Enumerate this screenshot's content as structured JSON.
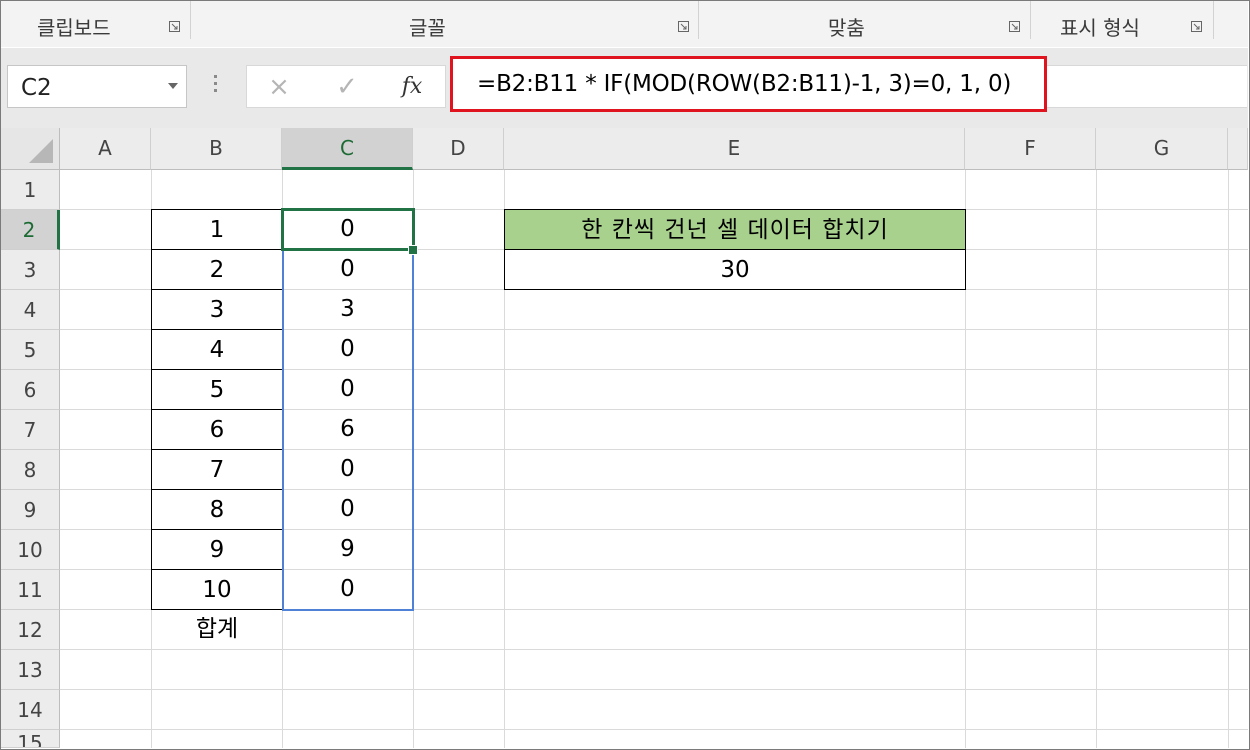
{
  "ribbon": {
    "groups": [
      "클립보드",
      "글꼴",
      "맞춤",
      "표시 형식"
    ],
    "launcher_icon": "dialog-launcher-icon"
  },
  "formula_bar": {
    "name_box": "C2",
    "cancel_icon": "×",
    "enter_icon": "✓",
    "fx_label": "fx",
    "formula": "=B2:B11 * IF(MOD(ROW(B2:B11)-1, 3)=0, 1, 0)",
    "highlight_color": "#e0141e"
  },
  "sheet": {
    "columns": [
      "A",
      "B",
      "C",
      "D",
      "E",
      "F",
      "G"
    ],
    "selected_column": "C",
    "rows": [
      "1",
      "2",
      "3",
      "4",
      "5",
      "6",
      "7",
      "8",
      "9",
      "10",
      "11",
      "12",
      "13",
      "14",
      "15"
    ],
    "selected_row": "2",
    "column_b": [
      "1",
      "2",
      "3",
      "4",
      "5",
      "6",
      "7",
      "8",
      "9",
      "10"
    ],
    "column_c": [
      "0",
      "0",
      "3",
      "0",
      "0",
      "6",
      "0",
      "0",
      "9",
      "0"
    ],
    "b12_label": "합계",
    "e2_title": "한 칸씩 건넌 셀 데이터 합치기",
    "e3_value": "30",
    "title_fill_color": "#a9d18e",
    "selection_color": "#217346",
    "range_color": "#4f81d7"
  }
}
